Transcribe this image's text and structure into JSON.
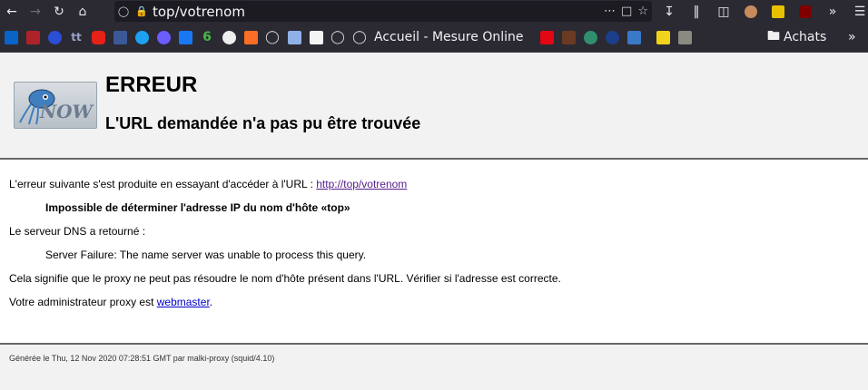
{
  "browser": {
    "url": "top/votrenom",
    "bookmarks": {
      "accueil_label": "Accueil - Mesure Online",
      "folder_label": "Achats"
    },
    "colors": {
      "toolbar_bg": "#2b2a33",
      "urlbar_bg": "#1c1b22"
    }
  },
  "page": {
    "heading": "ERREUR",
    "subheading": "L'URL demandée n'a pas pu être trouvée",
    "logo_text": "NOW",
    "line1_prefix": "L'erreur suivante s'est produite en essayant d'accéder à l'URL : ",
    "line1_link": "http://top/votrenom",
    "error_message": "Impossible de déterminer l'adresse IP du nom d'hôte «top»",
    "dns_label": "Le serveur DNS a retourné :",
    "dns_message": "Server Failure: The name server was unable to process this query.",
    "explanation": "Cela signifie que le proxy ne peut pas résoudre le nom d'hôte présent dans l'URL. Vérifier si l'adresse est correcte.",
    "admin_prefix": "Votre administrateur proxy est ",
    "admin_link": "webmaster",
    "admin_suffix": ".",
    "footer": "Générée le Thu, 12 Nov 2020 07:28:51 GMT par malki-proxy (squid/4.10)"
  }
}
